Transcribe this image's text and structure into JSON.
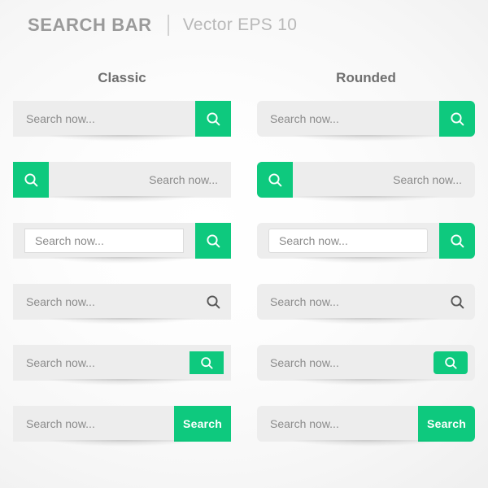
{
  "header": {
    "title": "SEARCH BAR",
    "subtitle": "Vector EPS 10"
  },
  "columns": [
    {
      "heading": "Classic"
    },
    {
      "heading": "Rounded"
    }
  ],
  "placeholder": "Search now...",
  "search_button_label": "Search",
  "icons": {
    "magnifier": "magnifier-icon"
  },
  "colors": {
    "green": "#0ec97e",
    "bar_background": "#ededed",
    "placeholder_text": "#8b8b8b",
    "icon_dark": "#555555",
    "icon_light": "#ffffff",
    "heading_text": "#6f6f6f",
    "title_text": "#9a9a9a",
    "subtitle_text": "#b9b9b9"
  },
  "variants": [
    {
      "name": "button-right-icon",
      "placeholder": "Search now...",
      "button": "icon-right"
    },
    {
      "name": "button-left-icon",
      "placeholder": "Search now...",
      "button": "icon-left"
    },
    {
      "name": "inset-field-icon",
      "placeholder": "Search now...",
      "button": "icon-right"
    },
    {
      "name": "plain-icon",
      "placeholder": "Search now...",
      "button": "bare-icon"
    },
    {
      "name": "inset-button-icon",
      "placeholder": "Search now...",
      "button": "icon-inset"
    },
    {
      "name": "text-button",
      "placeholder": "Search now...",
      "button": "text"
    }
  ]
}
